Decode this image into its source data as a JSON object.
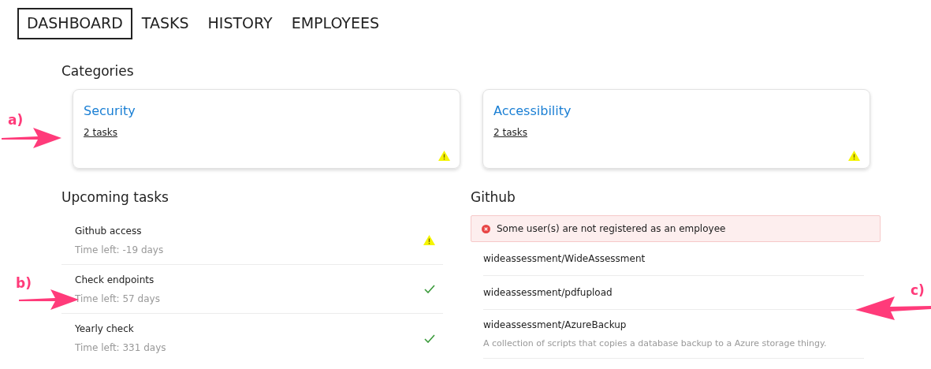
{
  "nav": [
    {
      "label": "DASHBOARD",
      "selected": true
    },
    {
      "label": "TASKS",
      "selected": false
    },
    {
      "label": "HISTORY",
      "selected": false
    },
    {
      "label": "EMPLOYEES",
      "selected": false
    }
  ],
  "categories": {
    "title": "Categories",
    "items": [
      {
        "name": "Security",
        "tasks": "2 tasks",
        "kind": "warning"
      },
      {
        "name": "Accessibility",
        "tasks": "2 tasks",
        "kind": "warning"
      }
    ]
  },
  "upcoming_tasks": {
    "title": "Upcoming tasks",
    "items": [
      {
        "name": "Github access",
        "time_left": "Time left: -19 days",
        "kind": "warning"
      },
      {
        "name": "Check endpoints",
        "time_left": "Time left: 57 days",
        "kind": "ok"
      },
      {
        "name": "Yearly check",
        "time_left": "Time left: 331 days",
        "kind": "ok"
      }
    ]
  },
  "github": {
    "title": "Github",
    "alert": "Some user(s) are not registered as an employee",
    "repos": [
      {
        "name": "wideassessment/WideAssessment"
      },
      {
        "name": "wideassessment/pdfupload"
      },
      {
        "name": "wideassessment/AzureBackup",
        "description": "A collection of scripts that copies a database backup to a Azure storage thingy."
      }
    ]
  },
  "annotations": [
    {
      "label": "a)"
    },
    {
      "label": "b)"
    },
    {
      "label": "c)"
    }
  ]
}
